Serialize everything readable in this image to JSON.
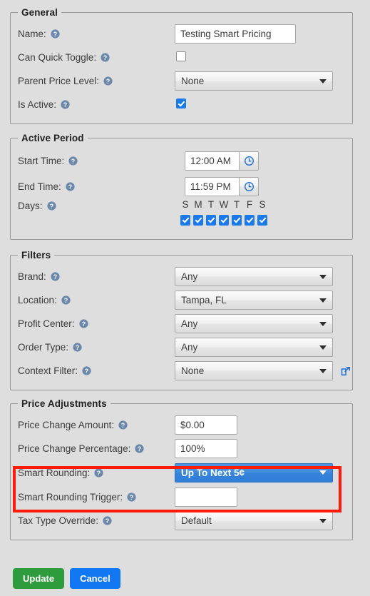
{
  "sections": {
    "general": {
      "legend": "General",
      "rows": [
        {
          "label": "Name:",
          "help": "help-icon",
          "control": "text",
          "value": "Testing Smart Pricing"
        },
        {
          "label": "Can Quick Toggle:",
          "help": "help-icon",
          "control": "checkbox",
          "checked": false
        },
        {
          "label": "Parent Price Level:",
          "help": "help-icon",
          "control": "select",
          "value": "None"
        },
        {
          "label": "Is Active:",
          "help": "help-icon",
          "control": "checkbox",
          "checked": true
        }
      ]
    },
    "active_period": {
      "legend": "Active Period",
      "rows": [
        {
          "label": "Start Time:",
          "control": "time",
          "value": "12:00 AM",
          "icon": "clock-icon"
        },
        {
          "label": "End Time:",
          "control": "time",
          "value": "11:59 PM",
          "icon": "clock-icon"
        },
        {
          "label": "Days:",
          "control": "days"
        }
      ],
      "day_initials": [
        "S",
        "M",
        "T",
        "W",
        "T",
        "F",
        "S"
      ],
      "day_names": [
        "Sunday",
        "Monday",
        "Tuesday",
        "Wednesday",
        "Thursday",
        "Friday",
        "Saturday"
      ],
      "day_checked": [
        true,
        true,
        true,
        true,
        true,
        true,
        true
      ]
    },
    "filters": {
      "legend": "Filters",
      "rows": [
        {
          "label": "Brand:",
          "control": "select",
          "value": "Any"
        },
        {
          "label": "Location:",
          "control": "select",
          "value": "Tampa, FL"
        },
        {
          "label": "Profit Center:",
          "control": "select",
          "value": "Any"
        },
        {
          "label": "Order Type:",
          "control": "select",
          "value": "Any"
        },
        {
          "label": "Context Filter:",
          "control": "select",
          "value": "None",
          "extra_icon": "external-link-icon"
        }
      ]
    },
    "price_adjustments": {
      "legend": "Price Adjustments",
      "rows": [
        {
          "label": "Price Change Amount:",
          "control": "text",
          "value": "$0.00"
        },
        {
          "label": "Price Change Percentage:",
          "control": "text",
          "value": "100%"
        },
        {
          "label": "Smart Rounding:",
          "control": "select",
          "value": "Up To Next 5¢",
          "highlighted": true
        },
        {
          "label": "Smart Rounding Trigger:",
          "control": "text",
          "value": ""
        },
        {
          "label": "Tax Type Override:",
          "control": "select",
          "value": "Default"
        }
      ]
    }
  },
  "annotation": {
    "type": "red-highlight-box",
    "color": "#ff1b09",
    "targets": [
      "Smart Rounding:",
      "Smart Rounding Trigger:"
    ]
  },
  "footer": {
    "update_label": "Update",
    "cancel_label": "Cancel"
  },
  "colors": {
    "page_background": "#dedede",
    "accent_blue": "#1a7aeb",
    "highlight_select": "#3683db",
    "annotation_red": "#ff1b09",
    "update_green": "#2e9c3c",
    "cancel_blue": "#1277f2",
    "help_icon": "#6b88ac"
  }
}
